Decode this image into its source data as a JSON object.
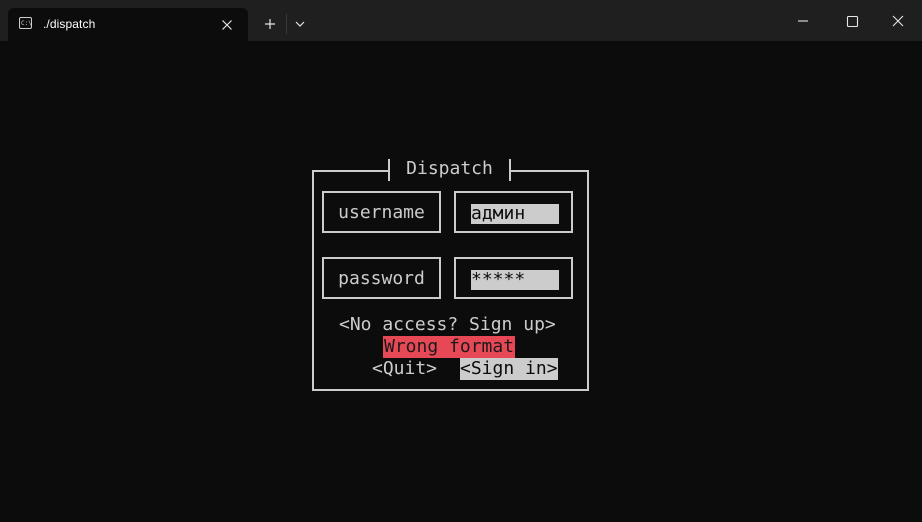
{
  "window": {
    "tab_title": "./dispatch",
    "tab_icon_text": "C:\\"
  },
  "form": {
    "title": "Dispatch",
    "username_label": "username",
    "username_value": "админ",
    "password_label": "password",
    "password_value": "*****",
    "signup_link": "<No access? Sign up>",
    "error_message": "Wrong format",
    "quit_button": "<Quit>",
    "signin_button": "<Sign in>"
  },
  "colors": {
    "background": "#0c0c0c",
    "titlebar": "#1f1f1f",
    "foreground": "#cccccc",
    "error_bg": "#e74856"
  },
  "icons": {
    "tab": "terminal-icon",
    "tab_close": "close-icon",
    "new_tab": "plus-icon",
    "dropdown": "chevron-down-icon",
    "minimize": "minimize-icon",
    "maximize": "maximize-icon",
    "close": "close-icon"
  }
}
